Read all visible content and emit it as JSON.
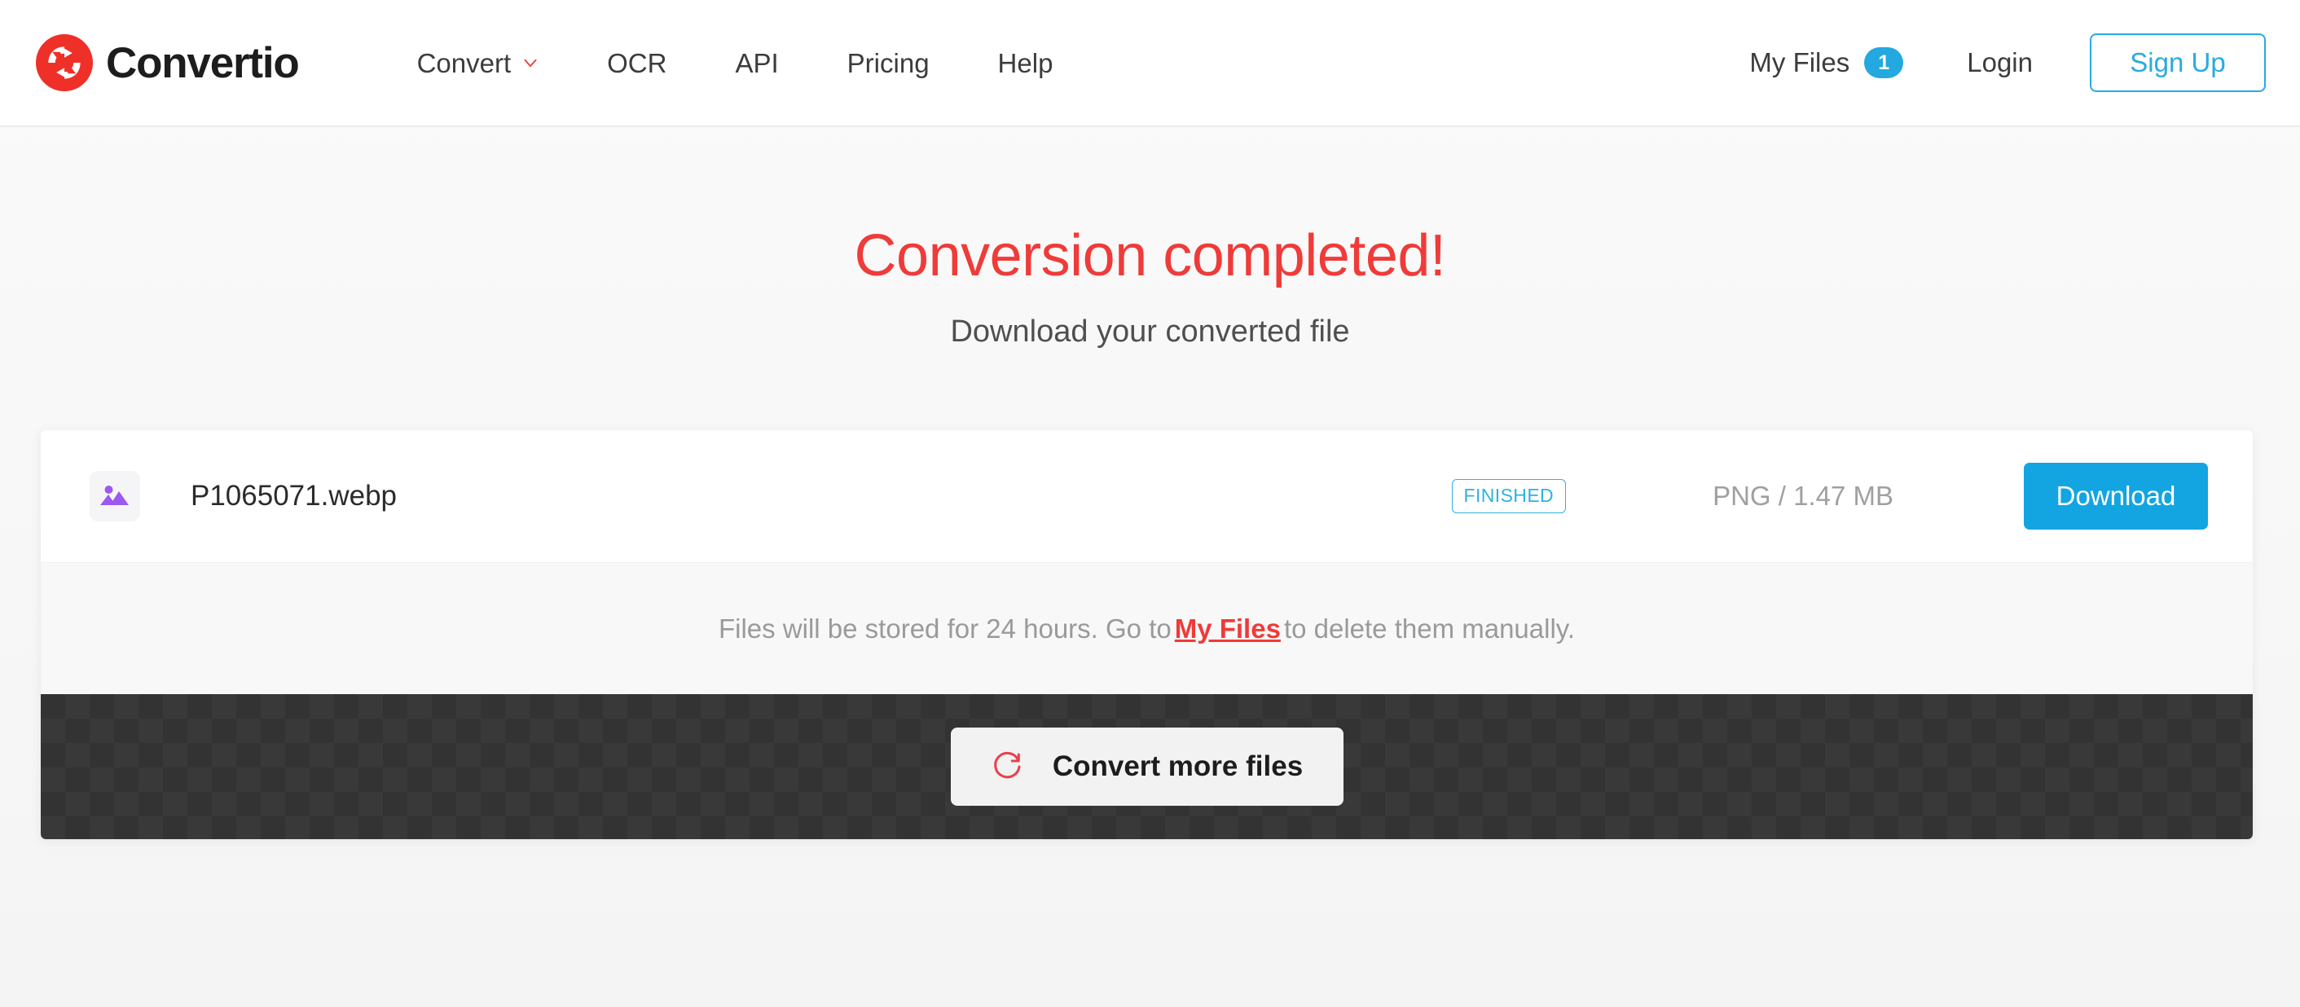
{
  "brand": {
    "name": "Convertio",
    "logo_icon": "convertio-circular-arrows-logo"
  },
  "header": {
    "nav": [
      {
        "label": "Convert",
        "icon": "chevron-down-icon",
        "has_dropdown": true
      },
      {
        "label": "OCR",
        "has_dropdown": false
      },
      {
        "label": "API",
        "has_dropdown": false
      },
      {
        "label": "Pricing",
        "has_dropdown": false
      },
      {
        "label": "Help",
        "has_dropdown": false
      }
    ],
    "my_files_label": "My Files",
    "my_files_count": "1",
    "login_label": "Login",
    "signup_label": "Sign Up"
  },
  "hero": {
    "title": "Conversion completed!",
    "subtitle": "Download your converted file"
  },
  "file_row": {
    "thumb_icon": "image-file-icon",
    "name": "P1065071.webp",
    "status": "FINISHED",
    "meta": "PNG / 1.47 MB",
    "download_label": "Download"
  },
  "notice": {
    "before_link": "Files will be stored for 24 hours. Go to",
    "link_label": "My Files",
    "after_link": "to delete them manually."
  },
  "footer": {
    "convert_more_label": "Convert more files",
    "convert_more_icon": "refresh-circular-arrow-icon"
  },
  "colors": {
    "brand_red": "#ef3b39",
    "accent_blue": "#12a5e2",
    "badge_blue": "#23a8e0",
    "status_cyan": "#2fb1e2",
    "thumb_purple": "#9b59f0",
    "dark_bar": "#333333",
    "page_bg": "#fafafa"
  }
}
